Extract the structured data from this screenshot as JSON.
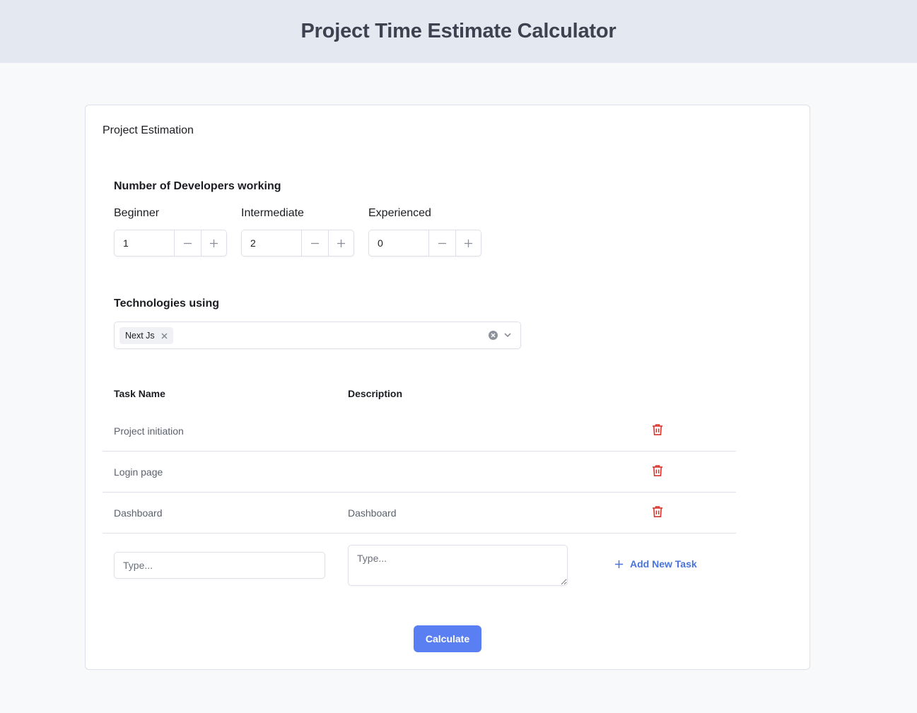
{
  "header": {
    "title": "Project Time Estimate Calculator"
  },
  "card": {
    "title": "Project Estimation"
  },
  "developers": {
    "heading": "Number of Developers working",
    "levels": [
      {
        "label": "Beginner",
        "value": "1"
      },
      {
        "label": "Intermediate",
        "value": "2"
      },
      {
        "label": "Experienced",
        "value": "0"
      }
    ]
  },
  "technologies": {
    "heading": "Technologies using",
    "selected": [
      "Next Js"
    ]
  },
  "tasks": {
    "columns": {
      "name": "Task Name",
      "description": "Description"
    },
    "rows": [
      {
        "name": "Project initiation",
        "description": ""
      },
      {
        "name": "Login page",
        "description": ""
      },
      {
        "name": "Dashboard",
        "description": "Dashboard"
      }
    ],
    "new_task": {
      "name_placeholder": "Type...",
      "description_placeholder": "Type...",
      "add_label": "Add New Task"
    }
  },
  "actions": {
    "calculate_label": "Calculate"
  },
  "colors": {
    "accent": "#5a7ff2",
    "link": "#4b73dc",
    "danger": "#d9342b",
    "header_bg": "#e4e8f0"
  },
  "icons": [
    "minus-icon",
    "plus-icon",
    "close-icon",
    "clear-circle-icon",
    "chevron-down-icon",
    "trash-icon"
  ]
}
